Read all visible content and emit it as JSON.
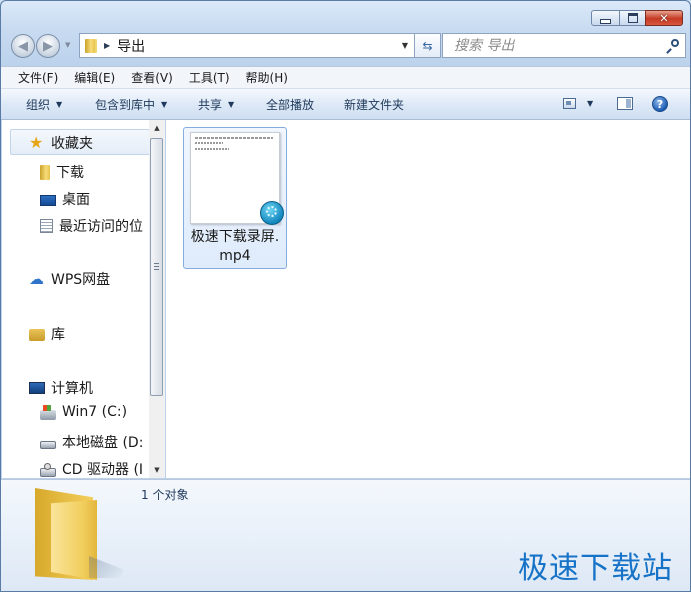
{
  "window": {
    "caption": {
      "minimize_symbol": "",
      "maximize_symbol": "",
      "close_symbol": "✕"
    }
  },
  "navbar": {
    "address_path": "导出",
    "search_placeholder": "搜索 导出"
  },
  "menu": [
    "文件(F)",
    "编辑(E)",
    "查看(V)",
    "工具(T)",
    "帮助(H)"
  ],
  "commands": {
    "organize": "组织",
    "include_in_library": "包含到库中",
    "share": "共享",
    "play_all": "全部播放",
    "new_folder": "新建文件夹"
  },
  "nav_pane": {
    "favorites": "收藏夹",
    "downloads": "下载",
    "desktop": "桌面",
    "recent": "最近访问的位",
    "wps_cloud": "WPS网盘",
    "libraries": "库",
    "computer": "计算机",
    "drive_c": "Win7 (C:)",
    "drive_d": "本地磁盘 (D:",
    "drive_cd": "CD 驱动器 (I"
  },
  "files": [
    {
      "name": "极速下载录屏.mp4",
      "icon": "video-file-icon"
    }
  ],
  "details": {
    "object_count": "1 个对象"
  },
  "watermark": "极速下载站",
  "colors": {
    "accent": "#1773c7",
    "selection": "#84acdd"
  }
}
